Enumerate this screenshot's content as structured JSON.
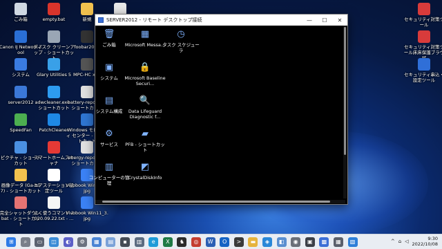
{
  "desktop": {
    "left_icons": [
      {
        "label": "ごみ箱",
        "icon": "recycle-bin-icon",
        "color": "#cfd8e3"
      },
      {
        "label": "empty.bat",
        "icon": "no-entry-icon",
        "color": "#d9342b"
      },
      {
        "label": "新規",
        "icon": "folder-icon",
        "color": "#f2c14e"
      },
      {
        "label": "",
        "icon": "file-icon",
        "color": "#e8e8e8"
      },
      {
        "label": "Canon IJ Network Tool",
        "icon": "canon-network-icon",
        "color": "#2a6fd6"
      },
      {
        "label": "ディスク クリーンアップ - ショートカット",
        "icon": "disk-cleanup-icon",
        "color": "#9aa6b5"
      },
      {
        "label": "foobar2000",
        "icon": "foobar-icon",
        "color": "#333333"
      },
      {
        "label": "システム",
        "icon": "system-icon",
        "color": "#3a7be0"
      },
      {
        "label": "Glary Utilities 5",
        "icon": "glary-icon",
        "color": "#39a0e8"
      },
      {
        "label": "MPC-HC x64",
        "icon": "mpc-icon",
        "color": "#555555"
      },
      {
        "label": "server2012",
        "icon": "remote-desktop-icon",
        "color": "#3b78d8"
      },
      {
        "label": "adwcleaner.exe - ショートカット",
        "icon": "adwcleaner-icon",
        "color": "#2d9bf0"
      },
      {
        "label": "battery-report.h - ショートカット",
        "icon": "battery-report-icon",
        "color": "#e0e0e0"
      },
      {
        "label": "SpeedFan",
        "icon": "speedfan-icon",
        "color": "#4caf50"
      },
      {
        "label": "PatchCleaner",
        "icon": "patchcleaner-icon",
        "color": "#1e88e5"
      },
      {
        "label": "Windows モビリティ センター - ショートカット",
        "icon": "mobility-center-icon",
        "color": "#2f76d2"
      },
      {
        "label": "ピクチャ - ショートカット",
        "icon": "pictures-folder-icon",
        "color": "#4a90e2"
      },
      {
        "label": "スマートホームスキャナ",
        "icon": "smart-home-scanner-icon",
        "color": "#e53935"
      },
      {
        "label": "energy-report.h - ショートカット",
        "icon": "energy-report-icon",
        "color": "#e0e0e0"
      },
      {
        "label": "画像データ (Ga-hô7) - ショートカット",
        "icon": "image-folder-icon",
        "color": "#f2c14e"
      },
      {
        "label": "エアステーション設定ツール",
        "icon": "airstation-icon",
        "color": "#ffffff"
      },
      {
        "label": "Vivobook Win11_1.jpg",
        "icon": "image-file-icon",
        "color": "#3b82f6"
      },
      {
        "label": "完全シャットダウン.bat - ショートカット",
        "icon": "shutdown-icon",
        "color": "#e57373"
      },
      {
        "label": "よく使うコマンド 2020.09.22.txt - ...",
        "icon": "text-file-icon",
        "color": "#f5f5f5"
      },
      {
        "label": "Vivobook Win11_3.jpg",
        "icon": "image-file-icon-2",
        "color": "#3b82f6"
      }
    ],
    "right_icons": [
      {
        "label": "セキュリティ対策ツール",
        "icon": "security-tool-icon",
        "color": "#d83b3b"
      },
      {
        "label": "セキュリティ対策ツール床床保護ブラウザ",
        "icon": "security-browser-icon",
        "color": "#d83b3b"
      },
      {
        "label": "セキュリティ串込・設定ツール",
        "icon": "security-settings-icon",
        "color": "#2f6fd8"
      }
    ]
  },
  "rdp": {
    "title": "SERVER2012 - リモート デスクトップ接続",
    "controls": {
      "minimize": "—",
      "maximize": "☐",
      "close": "✕"
    },
    "icons": [
      {
        "label": "ごみ箱",
        "icon": "recycle-bin-icon",
        "glyph": "🗑"
      },
      {
        "label": "Microsoft Messa...",
        "icon": "message-analyzer-icon",
        "glyph": "▦"
      },
      {
        "label": "タスク スケジューラ",
        "icon": "task-scheduler-icon",
        "glyph": "◷"
      },
      {
        "label": "システム",
        "icon": "system-icon",
        "glyph": "▣"
      },
      {
        "label": "Microsoft Baseline Securi...",
        "icon": "baseline-security-icon",
        "glyph": "🔒"
      },
      {
        "label": "システム構成",
        "icon": "system-config-icon",
        "glyph": "▤"
      },
      {
        "label": "Data Lifeguard Diagnostic f...",
        "icon": "data-lifeguard-icon",
        "glyph": "🔍"
      },
      {
        "label": "サービス",
        "icon": "services-icon",
        "glyph": "⚙"
      },
      {
        "label": "PFB - ショートカット",
        "icon": "pfb-folder-icon",
        "glyph": "▰"
      },
      {
        "label": "コンピューターの管理",
        "icon": "computer-management-icon",
        "glyph": "▥"
      },
      {
        "label": "CrystalDiskInfo",
        "icon": "crystaldiskinfo-icon",
        "glyph": "◩"
      }
    ]
  },
  "taskbar": {
    "apps": [
      {
        "name": "start-button",
        "color": "#2f7be6",
        "glyph": "⊞"
      },
      {
        "name": "search-icon",
        "color": "#7a7f8a",
        "glyph": "⌕"
      },
      {
        "name": "task-view-icon",
        "color": "#5b6270",
        "glyph": "▭"
      },
      {
        "name": "widgets-icon",
        "color": "#3a8bd6",
        "glyph": "◫"
      },
      {
        "name": "chat-icon",
        "color": "#5b5fc7",
        "glyph": "◐"
      },
      {
        "name": "settings-icon",
        "color": "#6b7280",
        "glyph": "⚙"
      },
      {
        "name": "control-panel-icon",
        "color": "#4a84d4",
        "glyph": "▦"
      },
      {
        "name": "app-pinned-1",
        "color": "#7aa2d8",
        "glyph": "▤"
      },
      {
        "name": "app-pinned-2",
        "color": "#444b55",
        "glyph": "▪"
      },
      {
        "name": "app-pinned-3",
        "color": "#5b6b80",
        "glyph": "▥"
      },
      {
        "name": "edge-icon",
        "color": "#1e9bd8",
        "glyph": "e"
      },
      {
        "name": "excel-icon",
        "color": "#1f7a45",
        "glyph": "X"
      },
      {
        "name": "app-pinned-4",
        "color": "#2b2b2b",
        "glyph": "♞"
      },
      {
        "name": "app-pinned-5",
        "color": "#c43d2f",
        "glyph": "◎"
      },
      {
        "name": "word-icon",
        "color": "#2b5fb4",
        "glyph": "W"
      },
      {
        "name": "outlook-icon",
        "color": "#1563c4",
        "glyph": "O"
      },
      {
        "name": "terminal-icon",
        "color": "#3a3a3a",
        "glyph": ">"
      },
      {
        "name": "file-explorer-icon",
        "color": "#e6b43c",
        "glyph": "▬"
      },
      {
        "name": "app-pinned-6",
        "color": "#2a88d8",
        "glyph": "◈"
      },
      {
        "name": "app-pinned-7",
        "color": "#5a8fd0",
        "glyph": "◧"
      },
      {
        "name": "camera-icon",
        "color": "#6a6f78",
        "glyph": "◉"
      },
      {
        "name": "app-pinned-8",
        "color": "#3b3f47",
        "glyph": "▣"
      },
      {
        "name": "remote-desktop-taskbar-icon",
        "color": "#3c6fd6",
        "glyph": "▩"
      },
      {
        "name": "app-pinned-9",
        "color": "#5a5f6b",
        "glyph": "▦"
      },
      {
        "name": "app-pinned-10",
        "color": "#2e7fd8",
        "glyph": "▧"
      }
    ],
    "time": "9:30",
    "date": "2022/10/08",
    "tray_up_arrow": "^",
    "tray_net": "⌂",
    "tray_vol": "◁"
  }
}
